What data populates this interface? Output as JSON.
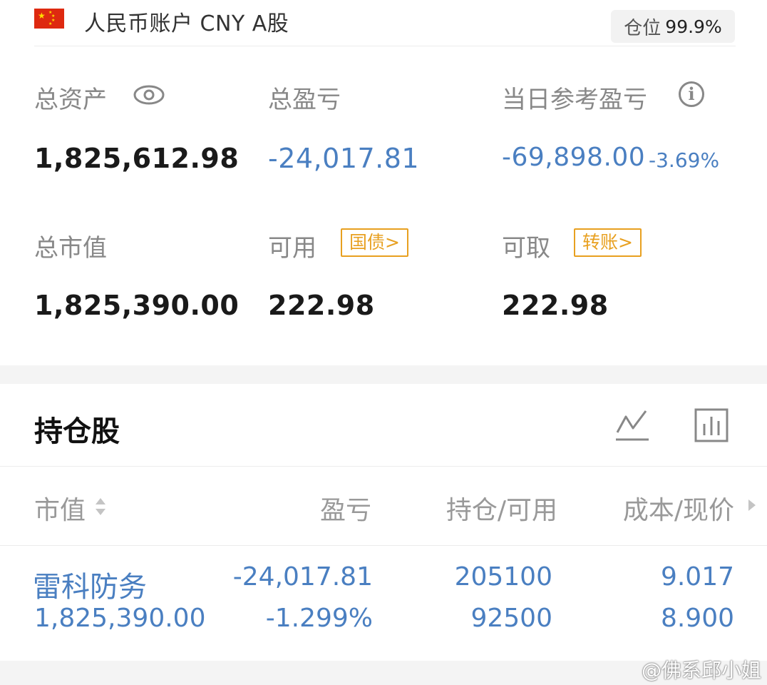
{
  "header": {
    "flag_icon": "china-flag-icon",
    "account_title": "人民币账户 CNY A股",
    "position_label": "仓位",
    "position_value": "99.9%"
  },
  "summary": {
    "total_assets_label": "总资产",
    "total_assets_value": "1,825,612.98",
    "total_pnl_label": "总盈亏",
    "total_pnl_value": "-24,017.81",
    "daily_pnl_label": "当日参考盈亏",
    "daily_pnl_value": "-69,898.00",
    "daily_pnl_pct": "-3.69%",
    "market_value_label": "总市值",
    "market_value_value": "1,825,390.00",
    "available_label": "可用",
    "available_tag": "国债>",
    "available_value": "222.98",
    "withdrawable_label": "可取",
    "withdrawable_tag": "转账>",
    "withdrawable_value": "222.98"
  },
  "holdings": {
    "title": "持仓股",
    "columns": [
      "市值",
      "盈亏",
      "持仓/可用",
      "成本/现价"
    ],
    "rows": [
      {
        "name": "雷科防务",
        "market_value": "1,825,390.00",
        "pnl": "-24,017.81",
        "pnl_pct": "-1.299%",
        "position": "205100",
        "available": "92500",
        "cost": "9.017",
        "price": "8.900"
      }
    ]
  },
  "watermark": "@佛系邱小姐",
  "colors": {
    "accent_blue": "#4a7fc1",
    "tag_orange": "#e8a020",
    "label_gray": "#888888"
  }
}
